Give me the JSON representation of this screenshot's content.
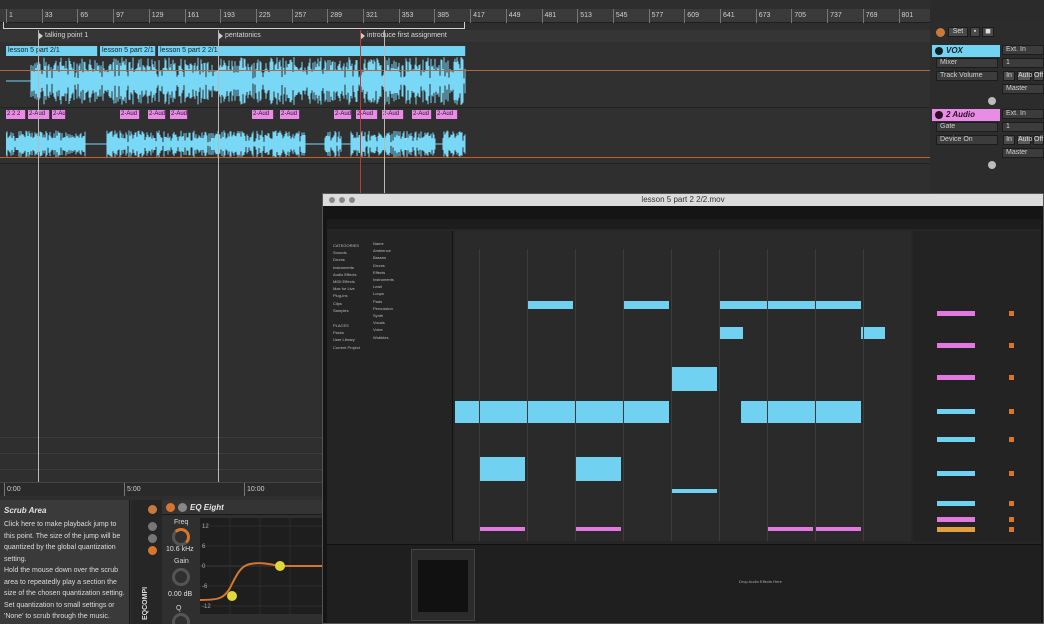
{
  "ruler": {
    "ticks": [
      "1",
      "33",
      "65",
      "97",
      "129",
      "161",
      "193",
      "225",
      "257",
      "289",
      "321",
      "353",
      "385",
      "417",
      "449",
      "481",
      "513",
      "545",
      "577",
      "609",
      "641",
      "673",
      "705",
      "737",
      "769",
      "801"
    ]
  },
  "locators": [
    "talking point 1",
    "pentatonics",
    "introduce first assignment"
  ],
  "tracks": {
    "vox_clips": [
      "lesson 5 part 2/1",
      "lesson 5 part 2/1",
      "lesson 5 part 2 2/1"
    ],
    "audio_clip_labels": [
      "2 2 2",
      "2-Aud",
      "2-Aud",
      "2-Aud",
      "2-Aud",
      "2-Aud",
      "2-Aud",
      "2-Aud",
      "2-Aud",
      "2-Aud",
      "2-Aud",
      "2-Aud",
      "2-Aud"
    ]
  },
  "bottom_ruler": [
    "0:00",
    "5:00",
    "10:00"
  ],
  "io_panel": {
    "set_label": "Set",
    "vox": {
      "name": "VOX",
      "input": "Ext. In",
      "dd1": "Mixer",
      "dd1_val": "1",
      "dd2": "Track Volume",
      "in": "In",
      "auto": "Auto",
      "off": "Off",
      "out": "Master"
    },
    "audio2": {
      "name": "2 Audio",
      "input": "Ext. In",
      "dd1": "Gate",
      "dd1_val": "1",
      "dd2": "Device On",
      "in": "In",
      "auto": "Auto",
      "off": "Off",
      "out": "Master"
    }
  },
  "video": {
    "title": "lesson 5 part 2 2/2.mov",
    "browser_categories": [
      "CATEGORIES",
      "Sounds",
      "Drums",
      "Instruments",
      "Audio Effects",
      "MIDI Effects",
      "Max for Live",
      "Plug-ins",
      "Clips",
      "Samples",
      "PLACES",
      "Packs",
      "User Library",
      "Current Project"
    ],
    "browser_items": [
      "Name",
      "Ambience",
      "Basses",
      "Drums",
      "Effects",
      "Instruments",
      "Lead",
      "Loops",
      "Pads",
      "Percussion",
      "Synth",
      "Vocals",
      "Voice",
      "Wobbles"
    ],
    "bottom_text": "Drop Audio Effects Here"
  },
  "help": {
    "title": "Scrub Area",
    "lines": [
      "Click here to make playback jump to",
      "this point. The size of the jump will be",
      "quantized by the global quantization",
      "setting.",
      "Hold the mouse down over the scrub",
      "area to repeatedly play a section the",
      "size of the chosen quantization setting.",
      "Set quantization to small settings or",
      "'None' to scrub through the music."
    ]
  },
  "eq": {
    "title": "EQ Eight",
    "side_label": "EQCOMPI",
    "freq_label": "Freq",
    "freq_value": "10.6 kHz",
    "gain_label": "Gain",
    "gain_value": "0.00 dB",
    "q_label": "Q",
    "scale": [
      "12",
      "6",
      "0",
      "-6",
      "-12"
    ]
  },
  "colors": {
    "clip_blue": "#72d4f2",
    "clip_pink": "#e98ce6",
    "accent_orange": "#c0622f",
    "eq_yellow": "#e0d83a"
  }
}
